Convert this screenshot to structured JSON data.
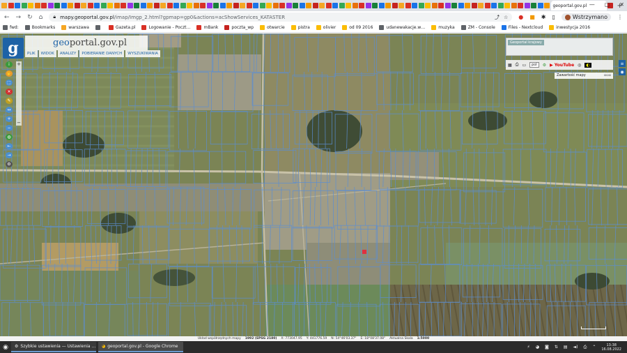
{
  "browser": {
    "active_tab_title": "geoportal.gov.pl",
    "url_host": "mapy.geoportal.gov.pl",
    "url_path": "/imap/Imgp_2.html?gpmap=gp0&actions=acShowServices_KATASTER",
    "pause_label": "Wstrzymano",
    "new_tab_glyph": "+",
    "tab_favicon_colors": [
      "#f5a623",
      "#d93025",
      "#1a73e8",
      "#34a853",
      "#fbbc04",
      "#e8710a",
      "#d93025",
      "#9334e6",
      "#188038",
      "#1a73e8",
      "#f29900",
      "#c5221f",
      "#f5a623",
      "#d93025",
      "#1a73e8",
      "#34a853",
      "#fbbc04",
      "#e8710a",
      "#d93025",
      "#9334e6",
      "#188038",
      "#1a73e8",
      "#f29900",
      "#c5221f",
      "#f5a623",
      "#d93025",
      "#1a73e8",
      "#34a853",
      "#fbbc04",
      "#e8710a",
      "#d93025",
      "#9334e6",
      "#188038",
      "#1a73e8",
      "#f29900",
      "#c5221f",
      "#f5a623",
      "#d93025",
      "#1a73e8",
      "#34a853",
      "#fbbc04",
      "#e8710a",
      "#d93025",
      "#9334e6",
      "#188038",
      "#1a73e8",
      "#f29900",
      "#c5221f",
      "#f5a623",
      "#d93025",
      "#1a73e8",
      "#34a853",
      "#fbbc04",
      "#e8710a",
      "#d93025",
      "#9334e6",
      "#188038",
      "#1a73e8",
      "#f29900",
      "#c5221f",
      "#f5a623",
      "#d93025",
      "#1a73e8",
      "#34a853",
      "#fbbc04",
      "#e8710a",
      "#d93025",
      "#9334e6",
      "#188038",
      "#1a73e8",
      "#f29900",
      "#c5221f",
      "#f5a623",
      "#d93025",
      "#1a73e8",
      "#34a853",
      "#fbbc04",
      "#e8710a",
      "#d93025",
      "#9334e6",
      "#188038",
      "#1a73e8",
      "#f29900",
      "#c5221f"
    ]
  },
  "bookmarks": [
    {
      "label": "fwd:",
      "color": "#5f6368"
    },
    {
      "label": "Bookmarks",
      "color": "#5f6368"
    },
    {
      "label": "warszawa",
      "color": "#f5a623"
    },
    {
      "label": "",
      "color": "#5f6368"
    },
    {
      "label": "Gazeta.pl",
      "color": "#d93025"
    },
    {
      "label": "Logowanie - Poczt…",
      "color": "#d93025"
    },
    {
      "label": "mBank",
      "color": "#d93025"
    },
    {
      "label": "poczta_wp",
      "color": "#c5221f"
    },
    {
      "label": "otwarcie",
      "color": "#fbbc04"
    },
    {
      "label": "pistra",
      "color": "#fbbc04"
    },
    {
      "label": "olivier",
      "color": "#fbbc04"
    },
    {
      "label": "od 09 2016",
      "color": "#fbbc04"
    },
    {
      "label": "udanewakacje.w…",
      "color": "#5f6368"
    },
    {
      "label": "muzyka",
      "color": "#fbbc04"
    },
    {
      "label": "ZM - Console",
      "color": "#5f6368"
    },
    {
      "label": "Files - Nextcloud",
      "color": "#1a73e8"
    },
    {
      "label": "inwestycja 2016",
      "color": "#fbbc04"
    }
  ],
  "geoportal": {
    "logo_letter": "g",
    "brand_prefix": "geo",
    "brand_rest": "portal.gov.pl",
    "menu": [
      "PLIK",
      "WIDOK",
      "ANALIZY",
      "POBIERANIE DANYCH",
      "WYSZUKIWANIA"
    ],
    "overview_title": "Geoportal krajowy",
    "language": "pol",
    "youtube": "YouTube",
    "content_label": "Zawartość mapy",
    "zoom_plus": "+",
    "zoom_minus": "−"
  },
  "statusbar": {
    "crs_label": "Układ współrzędnych mapy",
    "crs_value": "1992 (EPSG 2180)",
    "x": "X: 773047.95",
    "y": "Y: 441776.59",
    "lat": "N: 54°46'03.37\"",
    "lon": "E: 18°08'37.08\"",
    "scale_label": "Aktualna Skala",
    "scale_value": "1:5000"
  },
  "taskbar": {
    "tasks": [
      "Szybkie ustawienia — Ustawienia …",
      "geoportal.gov.pl - Google Chrome"
    ],
    "time": "13:38",
    "date": "16.08.2022"
  }
}
